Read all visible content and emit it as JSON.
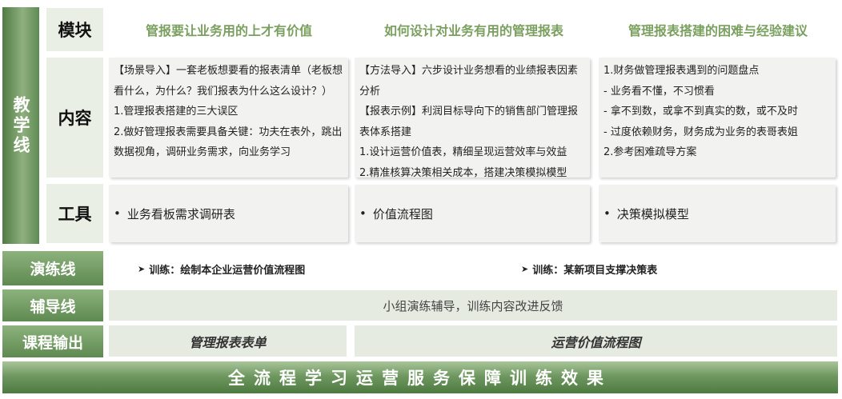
{
  "side_labels": {
    "teaching_line": "教学线",
    "practice_line": "演练线",
    "coaching_line": "辅导线",
    "course_output": "课程输出"
  },
  "row_headers": {
    "module": "模块",
    "content": "内容",
    "tools": "工具"
  },
  "modules": [
    {
      "title": "管报要让业务用的上才有价值",
      "content": [
        "【场景导入】一套老板想要看的报表清单（老板想看什么，为什么？我们报表为什么这么设计？）",
        "1.管理报表搭建的三大误区",
        "2.做好管理报表需要具备关键：功夫在表外，跳出数据视角，调研业务需求，向业务学习"
      ],
      "tool": "业务看板需求调研表"
    },
    {
      "title": "如何设计对业务有用的管理报表",
      "content": [
        "【方法导入】六步设计业务想看的业绩报表因素分析",
        "【报表示例】利润目标导向下的销售部门管理报表体系搭建",
        "1.设计运营价值表，精细呈现运营效率与效益",
        "2.精准核算决策相关成本，搭建决策模拟模型"
      ],
      "tool": "价值流程图"
    },
    {
      "title": "管理报表搭建的困难与经验建议",
      "content": [
        "1.财务做管理报表遇到的问题盘点",
        "- 业务看不懂，不习惯看",
        "- 拿不到数，或拿不到真实的数，或不及时",
        "- 过度依赖财务，财务成为业务的表哥表姐",
        "2.参考困难疏导方案"
      ],
      "tool": "决策模拟模型"
    }
  ],
  "practice": [
    "训练：绘制本企业运营价值流程图",
    "训练：某新项目支撑决策表"
  ],
  "coaching_text": "小组演练辅导，训练内容改进反馈",
  "outputs": [
    "管理报表表单",
    "运营价值流程图"
  ],
  "footer": "全流程学习运营服务保障训练效果",
  "colors": {
    "green_dark": "#5e8a50",
    "green_light": "#8db27d",
    "module_title": "#7aa05f",
    "light_bg": "#e9efe5",
    "card_bg": "#f2f2f0"
  },
  "icons": {
    "bullet": "bullet-dot",
    "arrow": "arrowhead-icon"
  }
}
